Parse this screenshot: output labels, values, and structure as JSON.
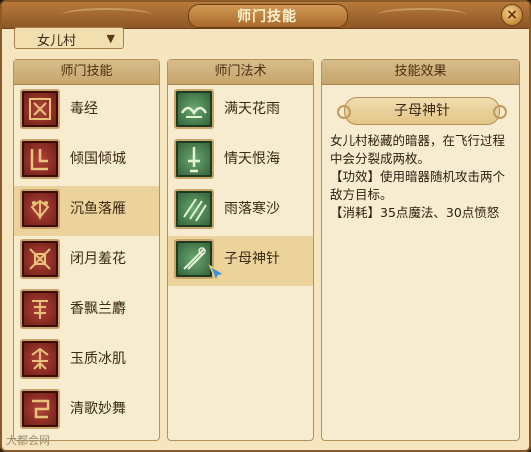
{
  "window": {
    "title": "师门技能",
    "close_label": "×"
  },
  "school_select": {
    "value": "女儿村",
    "arrow": "▼"
  },
  "skills": {
    "header": "师门技能",
    "items": [
      {
        "label": "毒经"
      },
      {
        "label": "倾国倾城"
      },
      {
        "label": "沉鱼落雁",
        "selected": true
      },
      {
        "label": "闭月羞花"
      },
      {
        "label": "香飘兰麝"
      },
      {
        "label": "玉质冰肌"
      },
      {
        "label": "清歌妙舞"
      }
    ]
  },
  "spells": {
    "header": "师门法术",
    "items": [
      {
        "label": "满天花雨"
      },
      {
        "label": "情天恨海"
      },
      {
        "label": "雨落寒沙"
      },
      {
        "label": "子母神针",
        "selected": true
      }
    ]
  },
  "effect": {
    "header": "技能效果",
    "name": "子母神针",
    "description": "女儿村秘藏的暗器，在飞行过程中会分裂成两枚。",
    "effect_line": "【功效】使用暗器随机攻击两个敌方目标。",
    "cost_line": "【消耗】35点魔法、30点愤怒"
  },
  "watermark": "大都会网"
}
